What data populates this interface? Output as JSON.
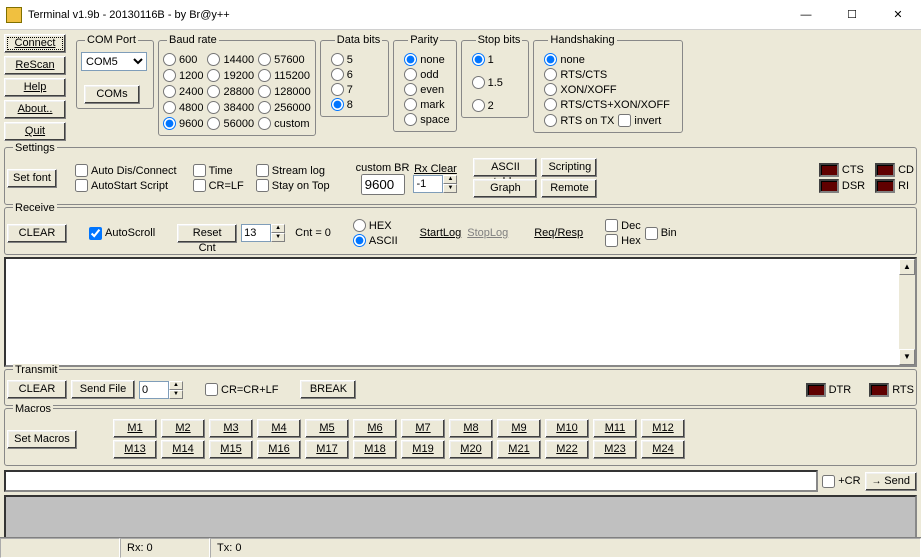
{
  "window": {
    "title": "Terminal v1.9b - 20130116B - by Br@y++"
  },
  "sidebar": {
    "connect": "Connect",
    "rescan": "ReScan",
    "help": "Help",
    "about": "About..",
    "quit": "Quit"
  },
  "comport": {
    "legend": "COM Port",
    "selected": "COM5",
    "btn": "COMs"
  },
  "baud": {
    "legend": "Baud rate",
    "items": [
      "600",
      "1200",
      "2400",
      "4800",
      "9600",
      "14400",
      "19200",
      "28800",
      "38400",
      "56000",
      "57600",
      "115200",
      "128000",
      "256000",
      "custom"
    ],
    "selected": "9600"
  },
  "databits": {
    "legend": "Data bits",
    "items": [
      "5",
      "6",
      "7",
      "8"
    ],
    "selected": "8"
  },
  "parity": {
    "legend": "Parity",
    "items": [
      "none",
      "odd",
      "even",
      "mark",
      "space"
    ],
    "selected": "none"
  },
  "stopbits": {
    "legend": "Stop bits",
    "items": [
      "1",
      "1.5",
      "2"
    ],
    "selected": "1"
  },
  "handshaking": {
    "legend": "Handshaking",
    "items": [
      "none",
      "RTS/CTS",
      "XON/XOFF",
      "RTS/CTS+XON/XOFF"
    ],
    "selected": "none",
    "rts_on_tx": "RTS on TX",
    "invert": "invert"
  },
  "settings": {
    "legend": "Settings",
    "setfont": "Set font",
    "auto_dis_connect": "Auto Dis/Connect",
    "autostart_script": "AutoStart Script",
    "time": "Time",
    "crlf": "CR=LF",
    "streamlog": "Stream log",
    "stayontop": "Stay on Top",
    "custom_br": "custom BR",
    "custom_br_val": "9600",
    "neg1": "-1",
    "rxclear": "Rx Clear",
    "ascii_table": "ASCII table",
    "graph": "Graph",
    "scripting": "Scripting",
    "remote": "Remote",
    "leds": {
      "cts": "CTS",
      "cd": "CD",
      "dsr": "DSR",
      "ri": "RI"
    }
  },
  "receive": {
    "legend": "Receive",
    "clear": "CLEAR",
    "autoscroll": "AutoScroll",
    "resetcnt": "Reset Cnt",
    "cnt_spin": "13",
    "cnt_label": "Cnt = ",
    "cnt_value": "0",
    "hex": "HEX",
    "ascii": "ASCII",
    "startlog": "StartLog",
    "stoplog": "StopLog",
    "reqresp": "Req/Resp",
    "dec": "Dec",
    "bin": "Bin",
    "hexchk": "Hex"
  },
  "transmit": {
    "legend": "Transmit",
    "clear": "CLEAR",
    "sendfile": "Send File",
    "spin": "0",
    "crcrlf": "CR=CR+LF",
    "break": "BREAK",
    "dtr": "DTR",
    "rts": "RTS"
  },
  "macros": {
    "legend": "Macros",
    "set": "Set Macros",
    "row1": [
      "M1",
      "M2",
      "M3",
      "M4",
      "M5",
      "M6",
      "M7",
      "M8",
      "M9",
      "M10",
      "M11",
      "M12"
    ],
    "row2": [
      "M13",
      "M14",
      "M15",
      "M16",
      "M17",
      "M18",
      "M19",
      "M20",
      "M21",
      "M22",
      "M23",
      "M24"
    ]
  },
  "sendline": {
    "cr": "+CR",
    "send": "Send"
  },
  "status": {
    "rx": "Rx: 0",
    "tx": "Tx: 0"
  }
}
